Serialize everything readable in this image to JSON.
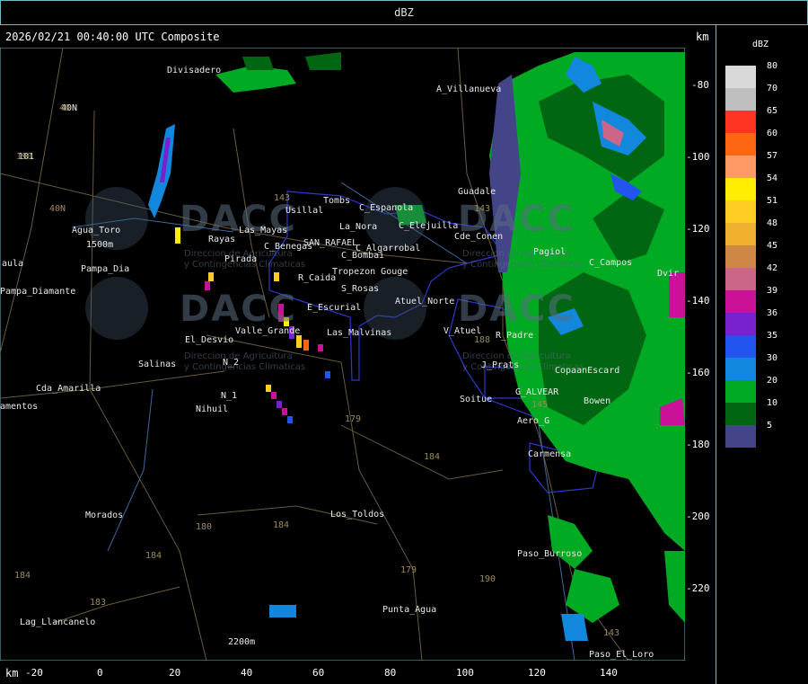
{
  "window": {
    "title": "dBZ"
  },
  "header": {
    "timestamp": "2026/02/21 00:40:00 UTC Composite",
    "unit_right": "km",
    "unit_bottom": "km"
  },
  "legend": {
    "title": "dBZ",
    "levels": [
      {
        "value": "80",
        "color": "#d9d9d9"
      },
      {
        "value": "70",
        "color": "#bfbfbf"
      },
      {
        "value": "65",
        "color": "#ff3322"
      },
      {
        "value": "60",
        "color": "#ff6611"
      },
      {
        "value": "57",
        "color": "#ff9966"
      },
      {
        "value": "54",
        "color": "#ffee00"
      },
      {
        "value": "51",
        "color": "#ffcc22"
      },
      {
        "value": "48",
        "color": "#f0b030"
      },
      {
        "value": "45",
        "color": "#cc8844"
      },
      {
        "value": "42",
        "color": "#cc6688"
      },
      {
        "value": "39",
        "color": "#cc1199"
      },
      {
        "value": "36",
        "color": "#7722cc"
      },
      {
        "value": "35",
        "color": "#2255ee"
      },
      {
        "value": "30",
        "color": "#1188dd"
      },
      {
        "value": "20",
        "color": "#00aa22"
      },
      {
        "value": "10",
        "color": "#006611"
      },
      {
        "value": "5",
        "color": "#444488"
      }
    ]
  },
  "y_ticks": [
    "-80",
    "-100",
    "-120",
    "-140",
    "-160",
    "-180",
    "-200",
    "-220"
  ],
  "x_ticks": [
    "-20",
    "0",
    "20",
    "40",
    "60",
    "80",
    "100",
    "120",
    "140"
  ],
  "places": [
    "Divisadero",
    "A_Villanueva",
    "40N",
    "101",
    "Tombs",
    "Usillal",
    "C_Espanola",
    "Guadale",
    "La_Nora",
    "C_Elejuilla",
    "Agua_Toro",
    "1500m",
    "Rayas",
    "Las_Mayas",
    "SAN_RAFAEL",
    "C_Algarrobal",
    "Atuel_Norte",
    "aula",
    "Pampa_Diamante",
    "Pampa_Dia",
    "Pirada",
    "R_Caida",
    "S_Rosas",
    "C_Benegas",
    "C_Bombai",
    "Tropezon Gouge",
    "Cde_Conen",
    "Pagiol",
    "C_Campos",
    "E_Escurial",
    "Valle_Grande",
    "Las_Malvinas",
    "El_Desvio",
    "Salinas",
    "N_2",
    "N_1",
    "Nihuil",
    "V_Atuel",
    "R_Padre",
    "J_Prats",
    "CopaanEscard",
    "G_ALVEAR",
    "Bowen",
    "Soitue",
    "Aero_G",
    "Carmensa",
    "Cda_Amarilla",
    "amentos",
    "Morados",
    "Los_Toldos",
    "Paso_Burroso",
    "Punta_Agua",
    "Lag_Llancanelo",
    "Paso_El_Loro",
    "2200m",
    "Dvir"
  ],
  "roads": [
    "143",
    "143",
    "40N",
    "179",
    "184",
    "180",
    "184",
    "179",
    "190",
    "184",
    "183",
    "145",
    "143",
    "184",
    "188",
    "190",
    "40"
  ],
  "watermark": {
    "brand": "DACC",
    "line1": "Direccion de Agricultura",
    "line2": "y Contingencias Climaticas"
  }
}
